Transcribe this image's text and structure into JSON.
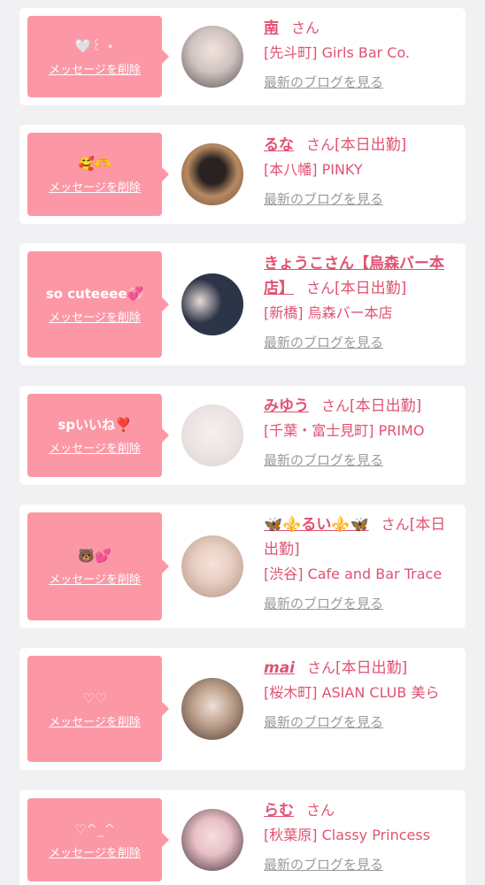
{
  "delete_label": "メッセージを削除",
  "blog_label": "最新のブログを見る",
  "san_label": "さん",
  "items": [
    {
      "message": "🤍꒰ ⋆",
      "name": "南",
      "status": "",
      "shop": "[先斗町] Girls Bar Co."
    },
    {
      "message": "🥰🫶",
      "name": "るな",
      "status": "[本日出勤]",
      "shop": "[本八幡] PINKY"
    },
    {
      "message": "so cuteeee💞",
      "name": "きょうこさん【烏森バー本店】",
      "status": "[本日出勤]",
      "shop": "[新橋] 烏森バー本店"
    },
    {
      "message": "spいいね❣️",
      "name": "みゆう",
      "status": "[本日出勤]",
      "shop": "[千葉・富士見町] PRIMO"
    },
    {
      "message": "🐻💕",
      "name": "🦋⚜️るい⚜️🦋",
      "status": "[本日出勤]",
      "shop": "[渋谷] Cafe and Bar Trace"
    },
    {
      "message": "♡♡",
      "name": "mai",
      "status": "[本日出勤]",
      "shop": "[桜木町] ASIAN CLUB 美ら"
    },
    {
      "message": "♡^_^",
      "name": "らむ",
      "status": "",
      "shop": "[秋葉原] Classy Princess"
    }
  ],
  "colors": {
    "bubble": "#fc97a6",
    "accent": "#e05272",
    "muted": "#9a9a9a",
    "background": "#f1f1f3"
  }
}
